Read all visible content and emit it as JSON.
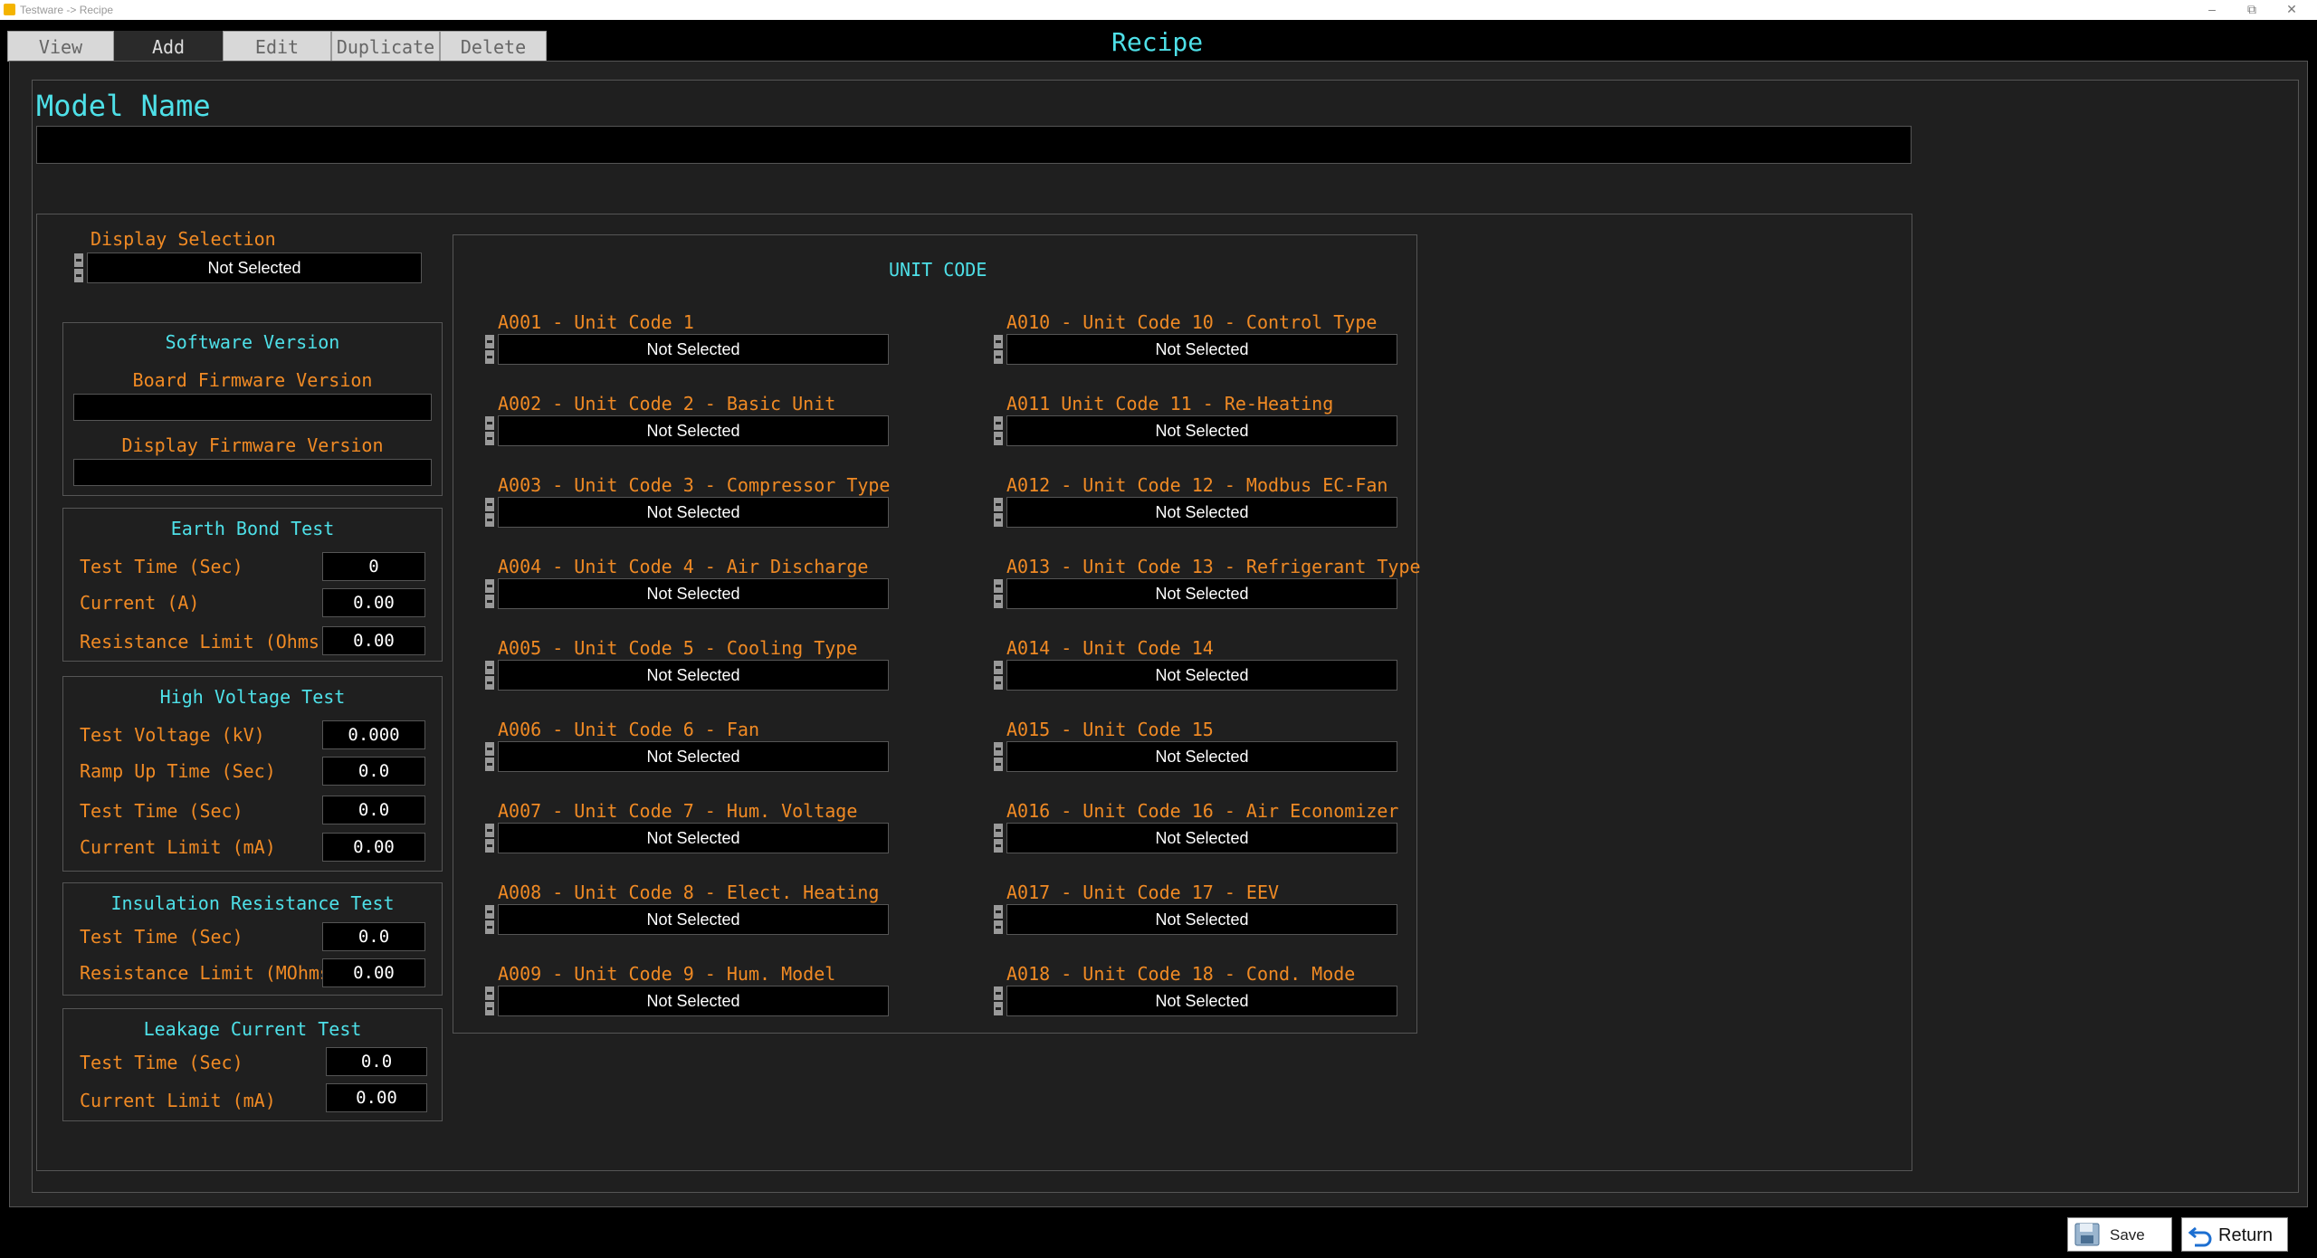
{
  "window": {
    "title": "Testware -> Recipe"
  },
  "tabs": [
    {
      "label": "View",
      "active": false
    },
    {
      "label": "Add",
      "active": true
    },
    {
      "label": "Edit",
      "active": false
    },
    {
      "label": "Duplicate",
      "active": false
    },
    {
      "label": "Delete",
      "active": false
    }
  ],
  "page": {
    "title": "Recipe"
  },
  "model": {
    "label": "Model Name",
    "value": ""
  },
  "display_selection": {
    "label": "Display Selection",
    "value": "Not Selected"
  },
  "software_version": {
    "title": "Software Version",
    "board_label": "Board Firmware Version",
    "board_value": "",
    "display_label": "Display Firmware Version",
    "display_value": ""
  },
  "earth_bond": {
    "title": "Earth Bond Test",
    "rows": [
      {
        "label": "Test Time (Sec)",
        "value": "0"
      },
      {
        "label": "Current (A)",
        "value": "0.00"
      },
      {
        "label": "Resistance Limit (Ohms)",
        "value": "0.00"
      }
    ]
  },
  "high_voltage": {
    "title": "High Voltage Test",
    "rows": [
      {
        "label": "Test Voltage (kV)",
        "value": "0.000"
      },
      {
        "label": "Ramp Up Time (Sec)",
        "value": "0.0"
      },
      {
        "label": "Test Time (Sec)",
        "value": "0.0"
      },
      {
        "label": "Current Limit (mA)",
        "value": "0.00"
      }
    ]
  },
  "insulation": {
    "title": "Insulation Resistance Test",
    "rows": [
      {
        "label": "Test Time (Sec)",
        "value": "0.0"
      },
      {
        "label": "Resistance Limit (MOhms)",
        "value": "0.00"
      }
    ]
  },
  "leakage": {
    "title": "Leakage Current Test",
    "rows": [
      {
        "label": "Test Time (Sec)",
        "value": "0.0"
      },
      {
        "label": "Current Limit (mA)",
        "value": "0.00"
      }
    ]
  },
  "unit_code": {
    "title": "UNIT CODE",
    "left": [
      {
        "label": "A001 - Unit Code 1",
        "value": "Not Selected"
      },
      {
        "label": "A002 - Unit Code 2 - Basic Unit",
        "value": "Not Selected"
      },
      {
        "label": "A003 - Unit Code 3 - Compressor Type",
        "value": "Not Selected"
      },
      {
        "label": "A004 - Unit Code 4 - Air Discharge",
        "value": "Not Selected"
      },
      {
        "label": "A005 - Unit Code 5 - Cooling Type",
        "value": "Not Selected"
      },
      {
        "label": "A006 - Unit Code 6 - Fan",
        "value": "Not Selected"
      },
      {
        "label": "A007 - Unit Code 7 - Hum. Voltage",
        "value": "Not Selected"
      },
      {
        "label": "A008 - Unit Code 8 - Elect. Heating",
        "value": "Not Selected"
      },
      {
        "label": "A009 - Unit Code 9 - Hum. Model",
        "value": "Not Selected"
      }
    ],
    "right": [
      {
        "label": "A010 - Unit Code 10 - Control Type",
        "value": "Not Selected"
      },
      {
        "label": "A011 Unit Code 11 - Re-Heating",
        "value": "Not Selected"
      },
      {
        "label": "A012 - Unit Code 12 - Modbus EC-Fan",
        "value": "Not Selected"
      },
      {
        "label": "A013 - Unit Code 13 - Refrigerant Type",
        "value": "Not Selected"
      },
      {
        "label": "A014 - Unit Code 14",
        "value": "Not Selected"
      },
      {
        "label": "A015 - Unit Code 15",
        "value": "Not Selected"
      },
      {
        "label": "A016 - Unit Code 16 - Air Economizer",
        "value": "Not Selected"
      },
      {
        "label": "A017 - Unit Code 17 - EEV",
        "value": "Not Selected"
      },
      {
        "label": "A018 - Unit Code 18 - Cond. Mode",
        "value": "Not Selected"
      }
    ]
  },
  "footer": {
    "save_label": "Save",
    "return_label": "Return"
  },
  "icons": {
    "save": "floppy-disk-icon",
    "return": "return-arrow-icon"
  },
  "colors": {
    "accent": "#4ee0e8",
    "label": "#f08a24"
  }
}
